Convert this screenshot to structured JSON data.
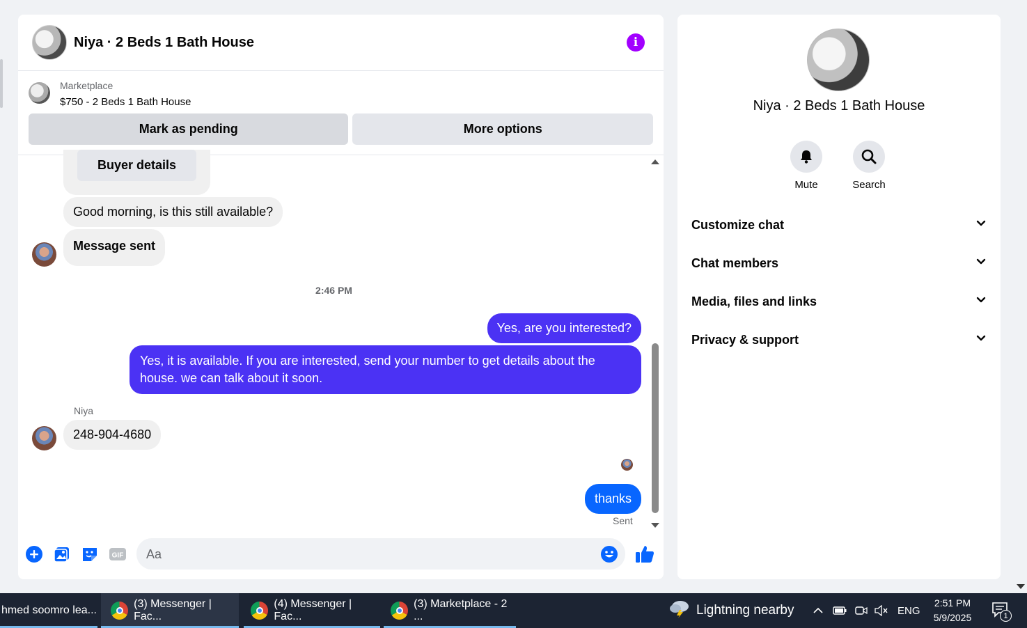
{
  "chat": {
    "title": "Niya · 2 Beds 1 Bath House",
    "marketplace_label": "Marketplace",
    "listing": "$750 - 2 Beds 1 Bath House",
    "mark_pending_label": "Mark as pending",
    "more_options_label": "More options"
  },
  "messages": {
    "buyer_details_label": "Buyer details",
    "in_1": "Good morning, is this still available?",
    "in_2": "Message sent",
    "timestamp": "2:46 PM",
    "out_1": "Yes, are you interested?",
    "out_2": "Yes, it is available. If you are interested, send your number to get details about the house. we can talk about it soon.",
    "sender_name": "Niya",
    "in_3": "248-904-4680",
    "out_3": "thanks",
    "status": "Sent"
  },
  "composer": {
    "placeholder": "Aa"
  },
  "info_panel": {
    "title": "Niya · 2 Beds 1 Bath House",
    "mute_label": "Mute",
    "search_label": "Search",
    "sections": [
      "Customize chat",
      "Chat members",
      "Media, files and links",
      "Privacy & support"
    ]
  },
  "taskbar": {
    "tasks": [
      "hmed soomro lea...",
      "(3) Messenger | Fac...",
      "(4) Messenger | Fac...",
      "(3) Marketplace - 2 ..."
    ],
    "weather": "Lightning nearby",
    "language": "ENG",
    "time": "2:51 PM",
    "date": "5/9/2025",
    "notification_count": "1"
  },
  "colors": {
    "accent_purple": "#a200ff",
    "outgoing_bubble": "#4b32f4",
    "outgoing_blue": "#0866ff",
    "messenger_blue": "#0866ff"
  }
}
